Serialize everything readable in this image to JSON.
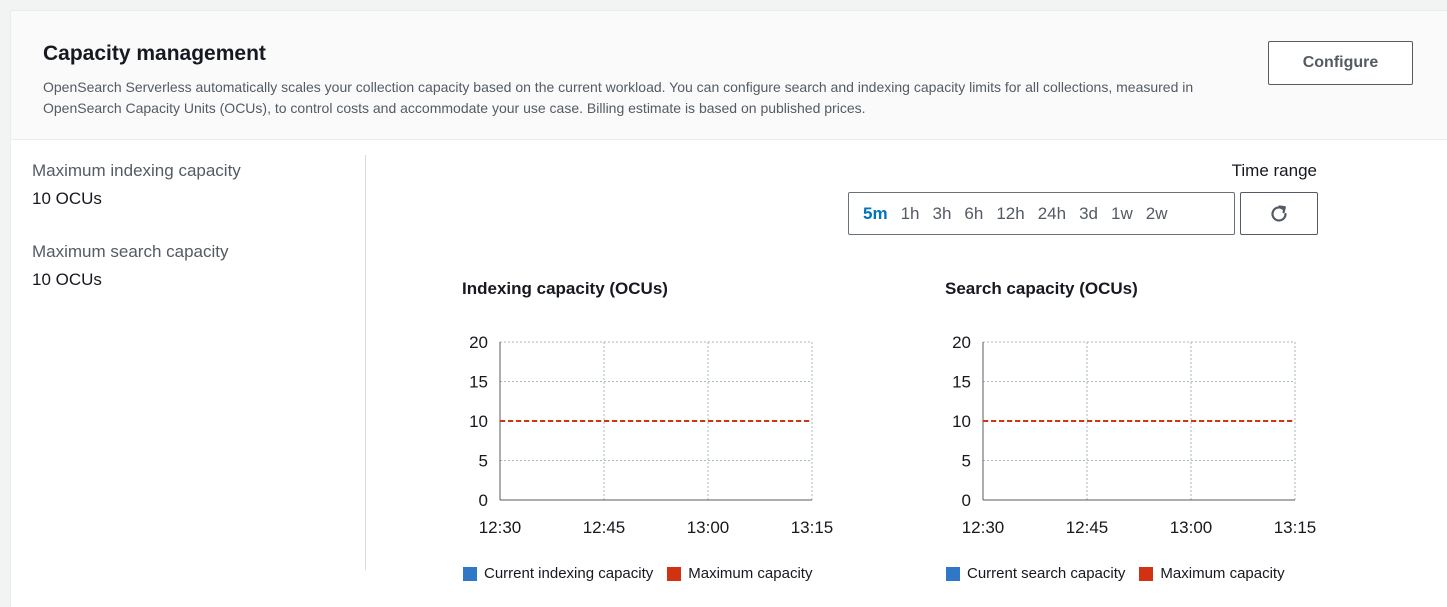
{
  "header": {
    "title": "Capacity management",
    "description": "OpenSearch Serverless automatically scales your collection capacity based on the current workload. You can configure search and indexing capacity limits for all collections, measured in OpenSearch Capacity Units (OCUs), to control costs and accommodate your use case. Billing estimate is based on published prices.",
    "configure_label": "Configure"
  },
  "summary": [
    {
      "label": "Maximum indexing capacity",
      "value": "10 OCUs"
    },
    {
      "label": "Maximum search capacity",
      "value": "10 OCUs"
    }
  ],
  "time_range": {
    "label": "Time range",
    "options": [
      "5m",
      "1h",
      "3h",
      "6h",
      "12h",
      "24h",
      "3d",
      "1w",
      "2w"
    ],
    "selected": "5m",
    "refresh_icon": "refresh-icon"
  },
  "colors": {
    "current": "#2e78c7",
    "maximum": "#d13212",
    "selected_range": "#0073bb"
  },
  "chart_data": [
    {
      "type": "line",
      "title": "Indexing capacity (OCUs)",
      "x": [
        "12:30",
        "12:45",
        "13:00",
        "13:15"
      ],
      "ylim": [
        0,
        20
      ],
      "yticks": [
        0,
        5,
        10,
        15,
        20
      ],
      "grid": true,
      "series": [
        {
          "name": "Current indexing capacity",
          "values": []
        },
        {
          "name": "Maximum capacity",
          "values": [
            10,
            10,
            10,
            10
          ],
          "style": "dashed"
        }
      ],
      "legend": "bottom"
    },
    {
      "type": "line",
      "title": "Search capacity (OCUs)",
      "x": [
        "12:30",
        "12:45",
        "13:00",
        "13:15"
      ],
      "ylim": [
        0,
        20
      ],
      "yticks": [
        0,
        5,
        10,
        15,
        20
      ],
      "grid": true,
      "series": [
        {
          "name": "Current search capacity",
          "values": []
        },
        {
          "name": "Maximum capacity",
          "values": [
            10,
            10,
            10,
            10
          ],
          "style": "dashed"
        }
      ],
      "legend": "bottom"
    }
  ]
}
